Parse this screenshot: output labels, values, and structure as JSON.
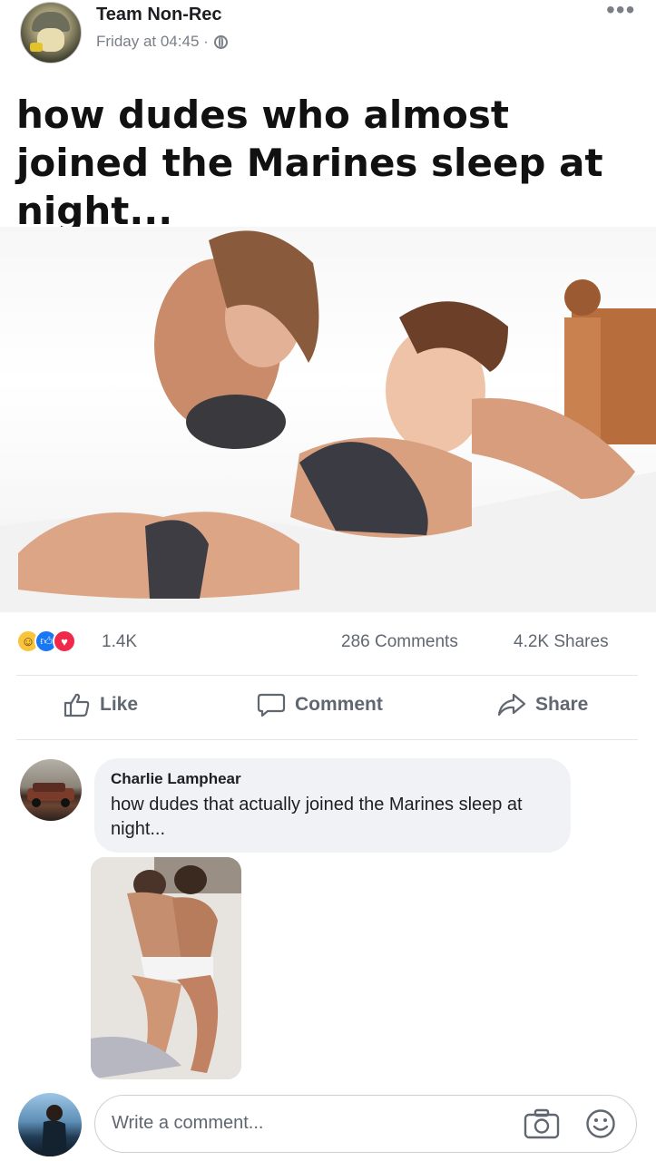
{
  "post": {
    "page_name": "Team Non-Rec",
    "timestamp": "Friday at 04:45 ·",
    "caption": "how dudes who almost joined the Marines sleep at night...",
    "reactions": [
      "haha-icon",
      "like-icon",
      "love-icon"
    ],
    "reaction_count": "1.4K",
    "comments_count": "286 Comments",
    "shares_count": "4.2K Shares"
  },
  "actions": {
    "like": "Like",
    "comment": "Comment",
    "share": "Share"
  },
  "comment": {
    "author": "Charlie Lamphear",
    "text": "how dudes that actually joined the Marines sleep at night..."
  },
  "composer": {
    "placeholder": "Write a comment..."
  },
  "colors": {
    "like_blue": "#1877f2",
    "love_red": "#f0284a",
    "haha_yellow": "#f7c43c",
    "secondary_text": "#606770"
  }
}
